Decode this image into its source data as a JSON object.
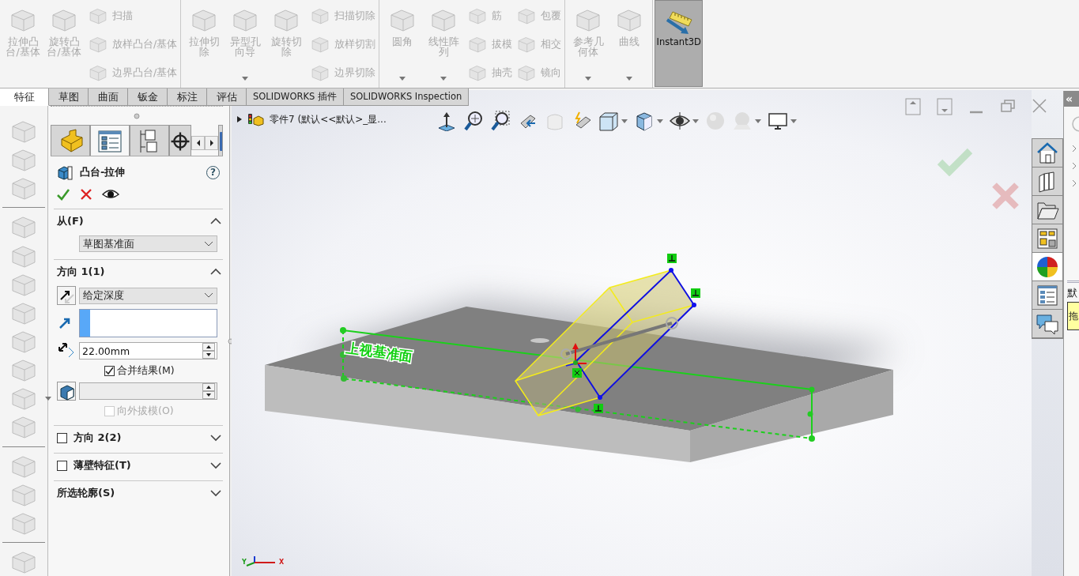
{
  "ribbon": {
    "groups": [
      {
        "large": [
          {
            "label": "拉伸凸台/基体",
            "disabled": true
          },
          {
            "label": "旋转凸台/基体",
            "disabled": true
          }
        ],
        "columns": [
          [
            {
              "label": "扫描",
              "disabled": true
            },
            {
              "label": "放样凸台/基体",
              "disabled": true
            },
            {
              "label": "边界凸台/基体",
              "disabled": true
            }
          ]
        ]
      },
      {
        "large": [
          {
            "label": "拉伸切除",
            "disabled": true
          },
          {
            "label": "异型孔向导",
            "disabled": true,
            "dropdown": true
          },
          {
            "label": "旋转切除",
            "disabled": true
          }
        ],
        "columns": [
          [
            {
              "label": "扫描切除",
              "disabled": true
            },
            {
              "label": "放样切割",
              "disabled": true
            },
            {
              "label": "边界切除",
              "disabled": true
            }
          ]
        ]
      },
      {
        "large": [
          {
            "label": "圆角",
            "disabled": true,
            "dropdown": true
          },
          {
            "label": "线性阵列",
            "disabled": true,
            "dropdown": true
          }
        ],
        "columns": [
          [
            {
              "label": "筋",
              "disabled": true
            },
            {
              "label": "拔模",
              "disabled": true
            },
            {
              "label": "抽壳",
              "disabled": true
            }
          ],
          [
            {
              "label": "包覆",
              "disabled": true
            },
            {
              "label": "相交",
              "disabled": true
            },
            {
              "label": "镜向",
              "disabled": true
            }
          ]
        ]
      },
      {
        "large": [
          {
            "label": "参考几何体",
            "disabled": true,
            "dropdown": true
          },
          {
            "label": "曲线",
            "disabled": true,
            "dropdown": true
          }
        ]
      }
    ],
    "instant3d": {
      "label": "Instant3D",
      "on": true
    }
  },
  "tabs": [
    {
      "label": "特征",
      "selected": true
    },
    {
      "label": "草图",
      "selected": false
    },
    {
      "label": "曲面",
      "selected": false
    },
    {
      "label": "钣金",
      "selected": false
    },
    {
      "label": "标注",
      "selected": false
    },
    {
      "label": "评估",
      "selected": false
    },
    {
      "label": "SOLIDWORKS 插件",
      "selected": false
    },
    {
      "label": "SOLIDWORKS Inspection",
      "selected": false
    }
  ],
  "property_manager": {
    "tabs": [
      {
        "kind": "feature",
        "selected": false
      },
      {
        "kind": "property",
        "selected": true
      },
      {
        "kind": "config",
        "selected": false
      },
      {
        "kind": "dimxpert",
        "selected": false
      },
      {
        "kind": "display",
        "selected": false
      }
    ],
    "title": "凸台-拉伸",
    "help": "?",
    "sections": [
      {
        "title": "从(F)",
        "expanded": true,
        "fields": [
          {
            "kind": "select",
            "value": "草图基准面"
          }
        ]
      },
      {
        "title": "方向 1(1)",
        "expanded": true,
        "fields": [
          {
            "kind": "select",
            "value": "给定深度"
          },
          {
            "kind": "selection"
          },
          {
            "kind": "spin",
            "value": "22.00mm",
            "disabled": false
          },
          {
            "kind": "checkbox",
            "label": "合并结果(M)",
            "checked": true,
            "disabled": false
          },
          {
            "kind": "spin",
            "disabled": true
          },
          {
            "kind": "checkbox",
            "label": "向外拔模(O)",
            "checked": false,
            "disabled": true
          }
        ]
      },
      {
        "title": "方向 2(2)",
        "expanded": false,
        "checked": false
      },
      {
        "title": "薄壁特征(T)",
        "expanded": false,
        "checked": false
      },
      {
        "title": "所选轮廓(S)",
        "expanded": false
      }
    ]
  },
  "viewport": {
    "tree_item": {
      "label": "零件7  (默认<<默认>_显...",
      "expanded": false
    },
    "plane_label": "上视基准面",
    "triad": {
      "y": "Y",
      "x": "X"
    }
  },
  "task_pane": {
    "tabs": [
      {
        "kind": "home",
        "selected": false
      },
      {
        "kind": "library",
        "selected": false
      },
      {
        "kind": "folder",
        "selected": false
      },
      {
        "kind": "palette",
        "selected": false
      },
      {
        "kind": "appearance",
        "selected": true
      },
      {
        "kind": "properties",
        "selected": false
      },
      {
        "kind": "forum",
        "selected": false
      }
    ],
    "collapse": "«",
    "heading": "默",
    "note": "拖"
  }
}
